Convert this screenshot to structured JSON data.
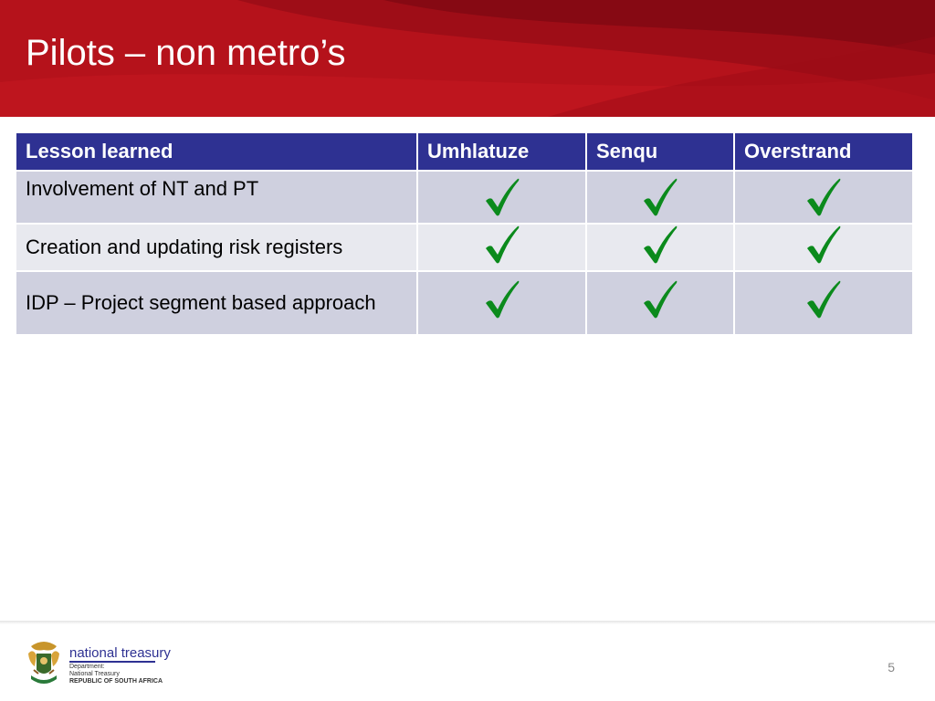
{
  "slide": {
    "title": "Pilots – non metro’s",
    "page_number": "5"
  },
  "table": {
    "headers": [
      "Lesson learned",
      "Umhlatuze",
      "Senqu",
      "Overstrand"
    ],
    "rows": [
      {
        "label": "Involvement of NT and PT",
        "checks": [
          true,
          true,
          true
        ]
      },
      {
        "label": "Creation and updating risk registers",
        "checks": [
          true,
          true,
          true
        ]
      },
      {
        "label": "IDP – Project segment based approach",
        "checks": [
          true,
          true,
          true
        ]
      }
    ]
  },
  "footer": {
    "org_name": "national treasury",
    "dept_line1": "Department:",
    "dept_line2": "National Treasury",
    "country": "REPUBLIC OF SOUTH AFRICA",
    "logo_icon": "coat-of-arms-icon"
  },
  "colors": {
    "header_red": "#b5121b",
    "table_header_navy": "#2e3192",
    "row_shade_dark": "#cfd0df",
    "row_shade_light": "#e8e9ef",
    "check_green": "#0b8a1c"
  }
}
